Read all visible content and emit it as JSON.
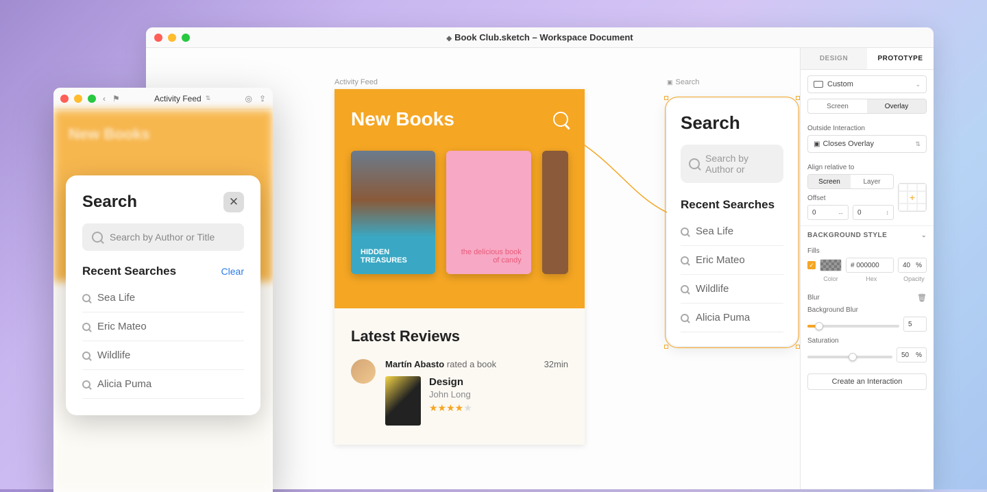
{
  "sketch": {
    "title": "Book Club.sketch – Workspace Document",
    "artboards": {
      "activity": {
        "label": "Activity Feed",
        "header": "New Books",
        "book1_title": "HIDDEN TREASURES",
        "book2_title": "the delicious book of candy",
        "reviews_title": "Latest Reviews",
        "review": {
          "author": "Martín Abasto",
          "action": "rated a book",
          "time": "32min",
          "book_title": "Design",
          "book_author": "John Long"
        }
      },
      "search": {
        "label": "Search",
        "title": "Search",
        "placeholder": "Search by Author or",
        "recent_title": "Recent Searches",
        "items": [
          "Sea Life",
          "Eric Mateo",
          "Wildlife",
          "Alicia Puma"
        ]
      }
    }
  },
  "inspector": {
    "tabs": {
      "design": "DESIGN",
      "prototype": "PROTOTYPE"
    },
    "device": "Custom",
    "overlay_toggle": {
      "screen": "Screen",
      "overlay": "Overlay"
    },
    "outside_label": "Outside Interaction",
    "outside_value": "Closes Overlay",
    "align_label": "Align relative to",
    "align_toggle": {
      "screen": "Screen",
      "layer": "Layer"
    },
    "offset_label": "Offset",
    "offset_x": "0",
    "offset_y": "0",
    "bg_header": "BACKGROUND STYLE",
    "fills_label": "Fills",
    "hex": "# 000000",
    "opacity": "40",
    "pct": "%",
    "color_label": "Color",
    "hex_label": "Hex",
    "opacity_label": "Opacity",
    "blur_label": "Blur",
    "bg_blur_label": "Background Blur",
    "blur_value": "5",
    "sat_label": "Saturation",
    "sat_value": "50",
    "create_btn": "Create an Interaction"
  },
  "preview": {
    "artboard_name": "Activity Feed",
    "bg_title": "New Books",
    "overlay": {
      "title": "Search",
      "placeholder": "Search by Author or Title",
      "recent_title": "Recent Searches",
      "clear": "Clear",
      "items": [
        "Sea Life",
        "Eric Mateo",
        "Wildlife",
        "Alicia Puma"
      ]
    }
  }
}
